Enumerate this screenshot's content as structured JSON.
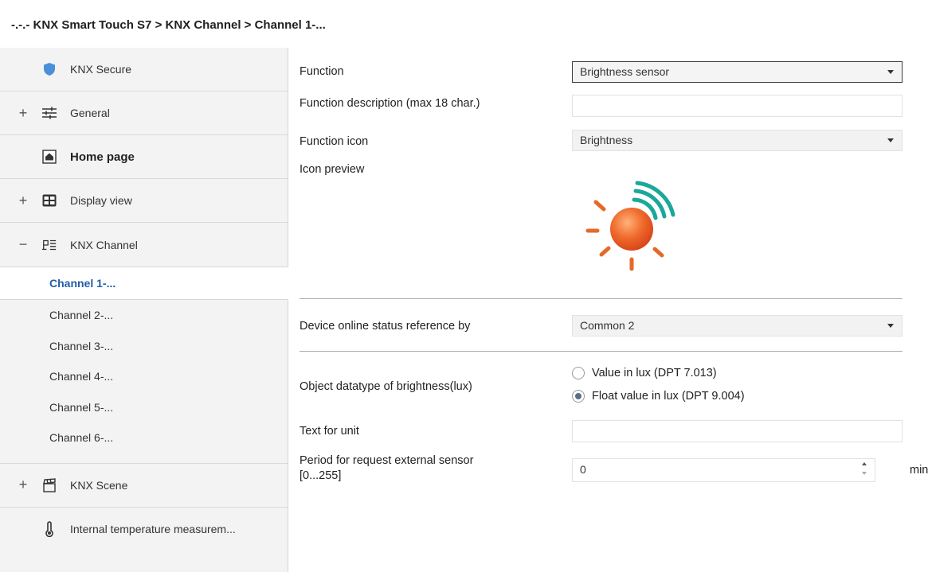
{
  "breadcrumb": "-.-.- KNX Smart Touch S7 > KNX Channel  > Channel 1-...",
  "sidebar": {
    "items": [
      {
        "label": "KNX Secure",
        "expander": "",
        "icon": "shield-icon"
      },
      {
        "label": "General",
        "expander": "+",
        "icon": "sliders-icon"
      },
      {
        "label": "Home page",
        "expander": "",
        "icon": "home-icon"
      },
      {
        "label": "Display view",
        "expander": "+",
        "icon": "grid-icon"
      },
      {
        "label": "KNX Channel",
        "expander": "−",
        "icon": "channel-icon"
      },
      {
        "label": "KNX Scene",
        "expander": "+",
        "icon": "clapper-icon"
      },
      {
        "label": "Internal temperature measurem...",
        "expander": "",
        "icon": "thermometer-icon"
      }
    ],
    "channels": [
      "Channel 1-...",
      "Channel 2-...",
      "Channel 3-...",
      "Channel 4-...",
      "Channel 5-...",
      "Channel 6-..."
    ],
    "active_channel": "Channel 1-..."
  },
  "form": {
    "function_label": "Function",
    "function_value": "Brightness sensor",
    "description_label": "Function description (max 18 char.)",
    "description_value": "",
    "icon_label": "Function icon",
    "icon_value": "Brightness",
    "preview_label": "Icon preview",
    "online_label": "Device online status reference by",
    "online_value": "Common 2",
    "datatype_label": "Object datatype of brightness(lux)",
    "datatype_options": [
      "Value in lux (DPT 7.013)",
      "Float value in lux (DPT 9.004)"
    ],
    "datatype_selected": "Float value in lux (DPT 9.004)",
    "unit_label": "Text for unit",
    "unit_value": "",
    "period_label_line1": "Period for request external sensor",
    "period_label_line2": "[0...255]",
    "period_value": "0",
    "period_unit": "min"
  },
  "colors": {
    "accent": "#1f5fa8",
    "shield": "#4a8fd8",
    "sun": "#e8501e",
    "rays": "#e56a2a",
    "waves": "#1aa89a"
  }
}
